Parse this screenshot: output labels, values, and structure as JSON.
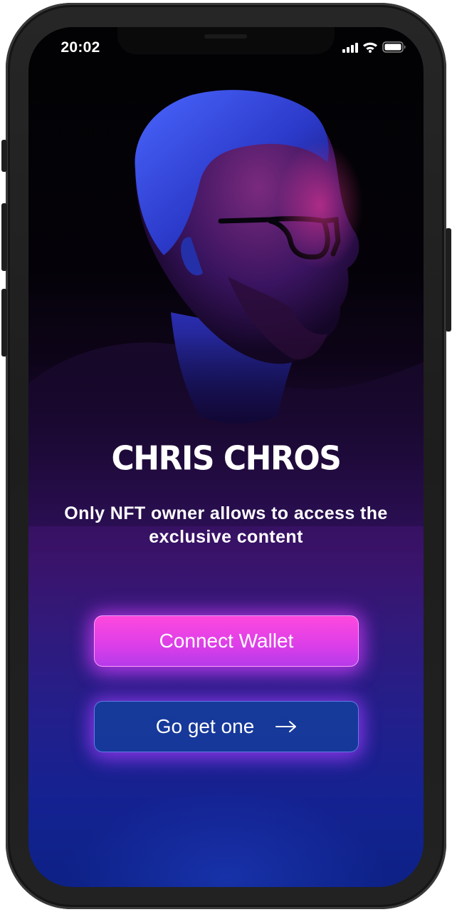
{
  "status_bar": {
    "time": "20:02",
    "icons": [
      "signal-icon",
      "wifi-icon",
      "battery-icon"
    ]
  },
  "hero": {
    "image": "portrait of man with glasses lit in blue and magenta",
    "title": "CHRIS CHROS",
    "subtitle": "Only NFT owner allows to access the exclusive content"
  },
  "actions": {
    "connect_label": "Connect Wallet",
    "get_label": "Go get one",
    "get_icon": "arrow-right-icon"
  },
  "colors": {
    "accent_pink": "#ff48dd",
    "accent_blue": "#153a9a",
    "background_dark": "#020103",
    "background_purple": "#3a136b"
  }
}
